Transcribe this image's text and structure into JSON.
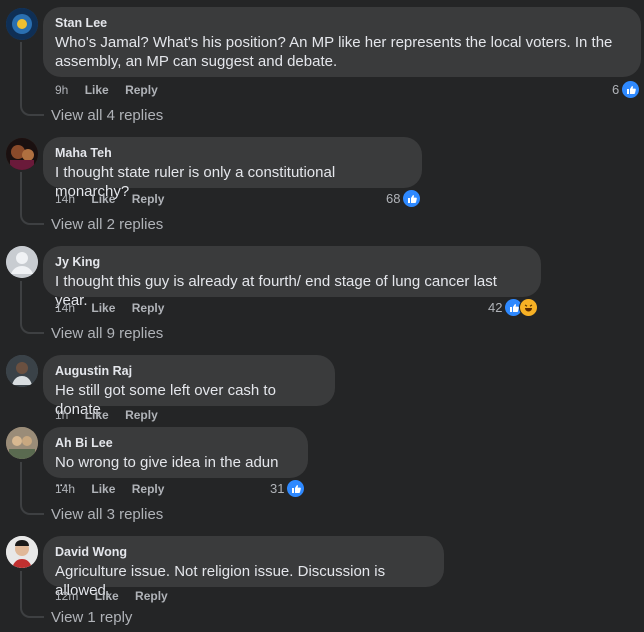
{
  "comments": [
    {
      "author": "Stan Lee",
      "text": "Who's Jamal? What's his position? An MP like her represents the local voters. In the assembly, an MP can suggest and debate.",
      "time": "9h",
      "like": "Like",
      "reply": "Reply",
      "reaction_count": "6",
      "view_replies": "View all 4 replies",
      "avatar_color": "#1c4a7a"
    },
    {
      "author": "Maha Teh",
      "text": "I thought state ruler is only a constitutional monarchy?",
      "time": "14h",
      "like": "Like",
      "reply": "Reply",
      "reaction_count": "68",
      "view_replies": "View all 2 replies",
      "avatar_color": "#4a2a1a"
    },
    {
      "author": "Jy King",
      "text": "I thought this guy is already at fourth/ end stage of lung cancer last year.",
      "time": "14h",
      "like": "Like",
      "reply": "Reply",
      "reaction_count": "42",
      "view_replies": "View all 9 replies",
      "avatar_color": "#c8ccd1"
    },
    {
      "author": "Augustin Raj",
      "text": "He still got some left over cash to donate",
      "time": "1h",
      "like": "Like",
      "reply": "Reply",
      "avatar_color": "#4f5a60"
    },
    {
      "author": "Ah Bi Lee",
      "text": "No wrong to give idea in the adun ....",
      "time": "14h",
      "like": "Like",
      "reply": "Reply",
      "reaction_count": "31",
      "view_replies": "View all 3 replies",
      "avatar_color": "#8a7a66"
    },
    {
      "author": "David Wong",
      "text": "Agriculture issue. Not religion issue. Discussion is allowed.",
      "time": "12m",
      "like": "Like",
      "reply": "Reply",
      "view_replies": "View 1 reply",
      "avatar_color": "#d9d9d9"
    }
  ],
  "colors": {
    "like_blue": "#2e89ff",
    "haha_yellow": "#f7b125",
    "bubble": "#3a3b3c",
    "background": "#242526"
  },
  "icons": {
    "like": "thumbs-up-icon",
    "haha": "laughing-face-icon"
  }
}
